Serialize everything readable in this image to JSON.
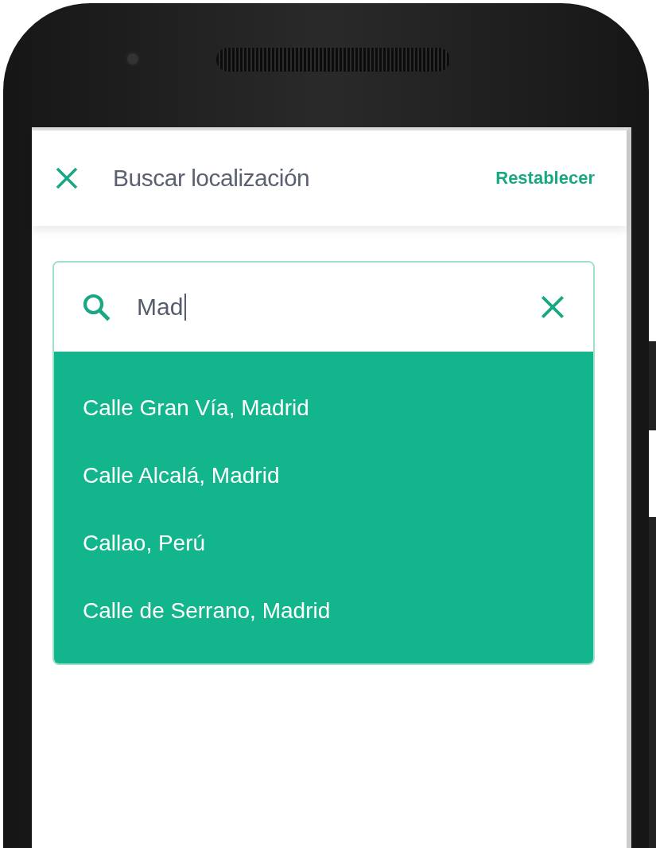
{
  "header": {
    "title": "Buscar localización",
    "action": "Restablecer"
  },
  "search": {
    "value": "Mad"
  },
  "suggestions": [
    {
      "label": "Calle Gran Vía, Madrid"
    },
    {
      "label": "Calle Alcalá, Madrid"
    },
    {
      "label": "Callao, Perú"
    },
    {
      "label": "Calle de Serrano, Madrid"
    }
  ]
}
